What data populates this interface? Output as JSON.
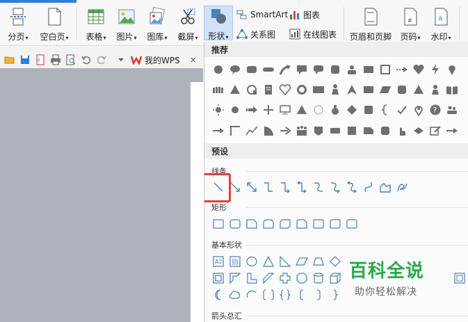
{
  "ribbon": {
    "buttons": [
      {
        "label": "分页",
        "icon": "page-break-icon"
      },
      {
        "label": "空白页",
        "icon": "blank-page-icon"
      },
      {
        "label": "表格",
        "icon": "table-icon"
      },
      {
        "label": "图片",
        "icon": "picture-icon"
      },
      {
        "label": "图库",
        "icon": "gallery-icon"
      },
      {
        "label": "截屏",
        "icon": "screenshot-icon"
      },
      {
        "label": "形状",
        "icon": "shapes-icon"
      },
      {
        "label": "页眉和页脚",
        "icon": "header-footer-icon"
      },
      {
        "label": "页码",
        "icon": "page-number-icon"
      },
      {
        "label": "水印",
        "icon": "watermark-icon"
      }
    ],
    "small": [
      {
        "label": "SmartArt",
        "icon": "smartart-icon"
      },
      {
        "label": "图表",
        "icon": "chart-icon"
      },
      {
        "label": "关系图",
        "icon": "relation-icon"
      },
      {
        "label": "在线图表",
        "icon": "online-chart-icon"
      }
    ]
  },
  "quick_toolbar": {
    "tab_label": "我的WPS",
    "tab_close": "×"
  },
  "shapes_panel": {
    "recommended_title": "推荐",
    "preset_title": "预设",
    "lines_title": "线条",
    "rect_title": "矩形",
    "basic_title": "基本形状",
    "arrows_title": "箭头总汇"
  },
  "watermark": {
    "title": "百科全说",
    "subtitle": "助你轻松解决"
  },
  "colors": {
    "accent": "#2f7fd8",
    "highlight": "#e0403a",
    "shape_gray": "#6f6f6f",
    "shape_blue": "#4a7fbf"
  }
}
